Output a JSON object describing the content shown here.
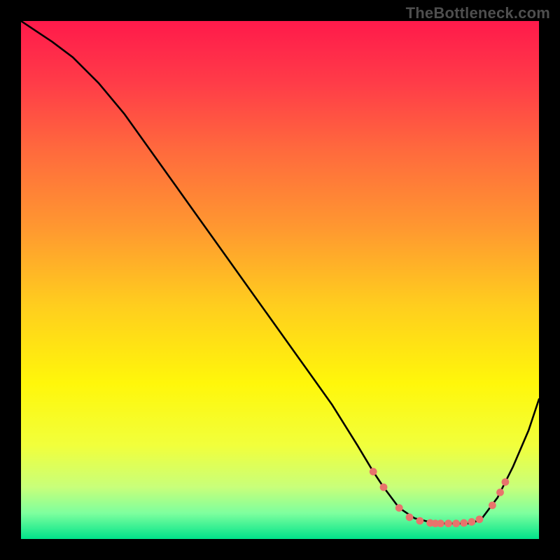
{
  "attribution": "TheBottleneck.com",
  "colors": {
    "background": "#000000",
    "curve": "#000000",
    "marker": "#e8736c",
    "attribution_text": "#4e4e4e"
  },
  "chart_data": {
    "type": "line",
    "title": "",
    "xlabel": "",
    "ylabel": "",
    "xlim": [
      0,
      100
    ],
    "ylim": [
      0,
      100
    ],
    "background_gradient": {
      "stops": [
        {
          "offset": 0.0,
          "color": "#ff1a4b"
        },
        {
          "offset": 0.12,
          "color": "#ff3c48"
        },
        {
          "offset": 0.25,
          "color": "#ff6a3d"
        },
        {
          "offset": 0.4,
          "color": "#ff9830"
        },
        {
          "offset": 0.55,
          "color": "#ffce1e"
        },
        {
          "offset": 0.7,
          "color": "#fff70a"
        },
        {
          "offset": 0.82,
          "color": "#f1ff3c"
        },
        {
          "offset": 0.9,
          "color": "#c8ff7a"
        },
        {
          "offset": 0.95,
          "color": "#7eff9e"
        },
        {
          "offset": 1.0,
          "color": "#00e38a"
        }
      ]
    },
    "series": [
      {
        "name": "bottleneck-curve",
        "x": [
          0,
          3,
          6,
          10,
          15,
          20,
          25,
          30,
          35,
          40,
          45,
          50,
          55,
          60,
          65,
          68,
          70,
          73,
          76,
          80,
          84,
          87,
          89,
          92,
          95,
          98,
          100
        ],
        "y": [
          100,
          98,
          96,
          93,
          88,
          82,
          75,
          68,
          61,
          54,
          47,
          40,
          33,
          26,
          18,
          13,
          10,
          6,
          4,
          3,
          3,
          3,
          4,
          8,
          14,
          21,
          27
        ]
      }
    ],
    "markers": {
      "series": "bottleneck-curve",
      "points": [
        {
          "x": 68,
          "y": 13
        },
        {
          "x": 70,
          "y": 10
        },
        {
          "x": 73,
          "y": 6
        },
        {
          "x": 75,
          "y": 4.2
        },
        {
          "x": 77,
          "y": 3.5
        },
        {
          "x": 79,
          "y": 3.1
        },
        {
          "x": 80,
          "y": 3
        },
        {
          "x": 81,
          "y": 3
        },
        {
          "x": 82.5,
          "y": 3
        },
        {
          "x": 84,
          "y": 3
        },
        {
          "x": 85.5,
          "y": 3.1
        },
        {
          "x": 87,
          "y": 3.3
        },
        {
          "x": 88.5,
          "y": 3.8
        },
        {
          "x": 91,
          "y": 6.5
        },
        {
          "x": 92.5,
          "y": 9
        },
        {
          "x": 93.5,
          "y": 11
        }
      ]
    }
  }
}
